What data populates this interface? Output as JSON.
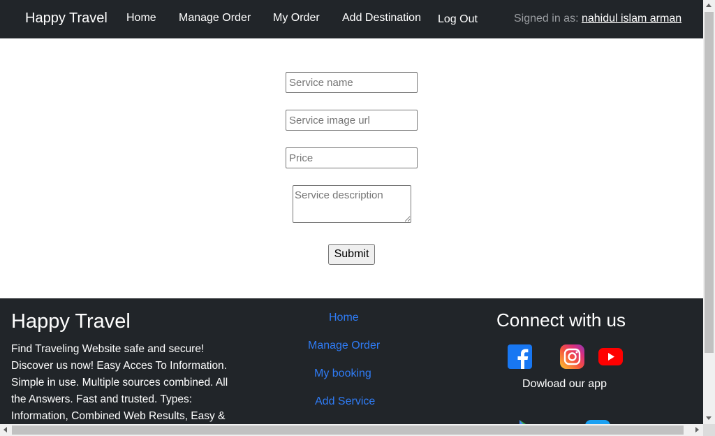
{
  "navbar": {
    "brand": "Happy Travel",
    "links": [
      "Home",
      "Manage Order",
      "My Order",
      "Add Destination",
      "Log Out"
    ],
    "signed_in_prefix": "Signed in as: ",
    "user_name": "nahidul islam arman"
  },
  "form": {
    "service_name_placeholder": "Service name",
    "service_image_placeholder": "Service image url",
    "price_placeholder": "Price",
    "description_placeholder": "Service description",
    "submit_label": "Submit"
  },
  "footer": {
    "brand": "Happy Travel",
    "description": "Find Traveling Website safe and secure! Discover us now! Easy Acces To Information. Simple in use. Multiple sources combined. All the Answers. Fast and trusted. Types: Information, Combined Web Results, Easy &",
    "links": [
      "Home",
      "Manage Order",
      "My booking",
      "Add Service"
    ],
    "connect_title": "Connect with us",
    "download_text": "Dowload our app",
    "social_icons": [
      "facebook-icon",
      "instagram-icon",
      "youtube-icon"
    ],
    "app_icons": [
      "google-play-icon",
      "app-store-icon"
    ]
  },
  "colors": {
    "dark_bg": "#212529",
    "link_blue": "#2f7cf6",
    "facebook_blue": "#1877f2",
    "youtube_red": "#ff0000"
  }
}
